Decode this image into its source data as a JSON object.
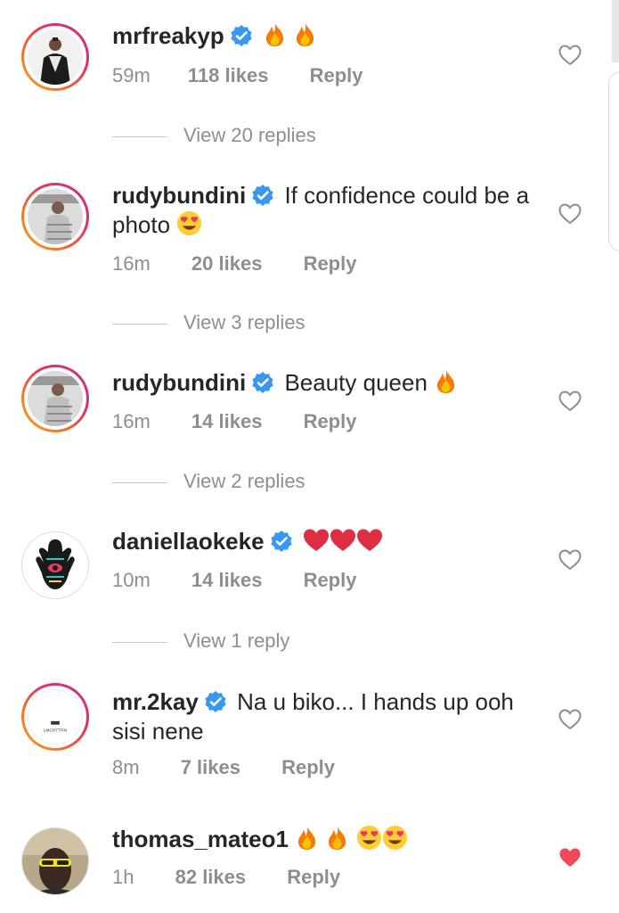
{
  "comments": [
    {
      "username": "mrfreakyp",
      "verified": true,
      "text": "",
      "emojis": [
        "fire",
        "fire"
      ],
      "time": "59m",
      "likes": "118 likes",
      "reply": "Reply",
      "liked": false,
      "view_replies": "View 20 replies"
    },
    {
      "username": "rudybundini",
      "verified": true,
      "text_line1": "If confidence could be a",
      "text_line2": "photo",
      "emojis": [
        "heart-eyes"
      ],
      "time": "16m",
      "likes": "20 likes",
      "reply": "Reply",
      "liked": false,
      "view_replies": "View 3 replies"
    },
    {
      "username": "rudybundini",
      "verified": true,
      "text": "Beauty queen",
      "emojis": [
        "fire"
      ],
      "time": "16m",
      "likes": "14 likes",
      "reply": "Reply",
      "liked": false,
      "view_replies": "View 2 replies"
    },
    {
      "username": "daniellaokeke",
      "verified": true,
      "text": "",
      "emojis": [
        "red-heart",
        "red-heart",
        "red-heart"
      ],
      "time": "10m",
      "likes": "14 likes",
      "reply": "Reply",
      "liked": false,
      "view_replies": "View 1 reply"
    },
    {
      "username": "mr.2kay",
      "verified": true,
      "text_line1": "Na u biko... I hands up ooh",
      "text_line2": "sisi nene",
      "emojis": [],
      "time": "8m",
      "likes": "7 likes",
      "reply": "Reply",
      "liked": false
    },
    {
      "username": "thomas_mateo1",
      "verified": false,
      "text": "",
      "emojis": [
        "fire",
        "fire",
        "heart-eyes",
        "heart-eyes"
      ],
      "time": "1h",
      "likes": "82 likes",
      "reply": "Reply",
      "liked": true
    }
  ],
  "avatar_logo_text": "LMCRTTRN",
  "colors": {
    "verified_blue": "#3897f0",
    "liked_red": "#ed4956",
    "meta_gray": "#8e8e8e",
    "text": "#262626"
  }
}
